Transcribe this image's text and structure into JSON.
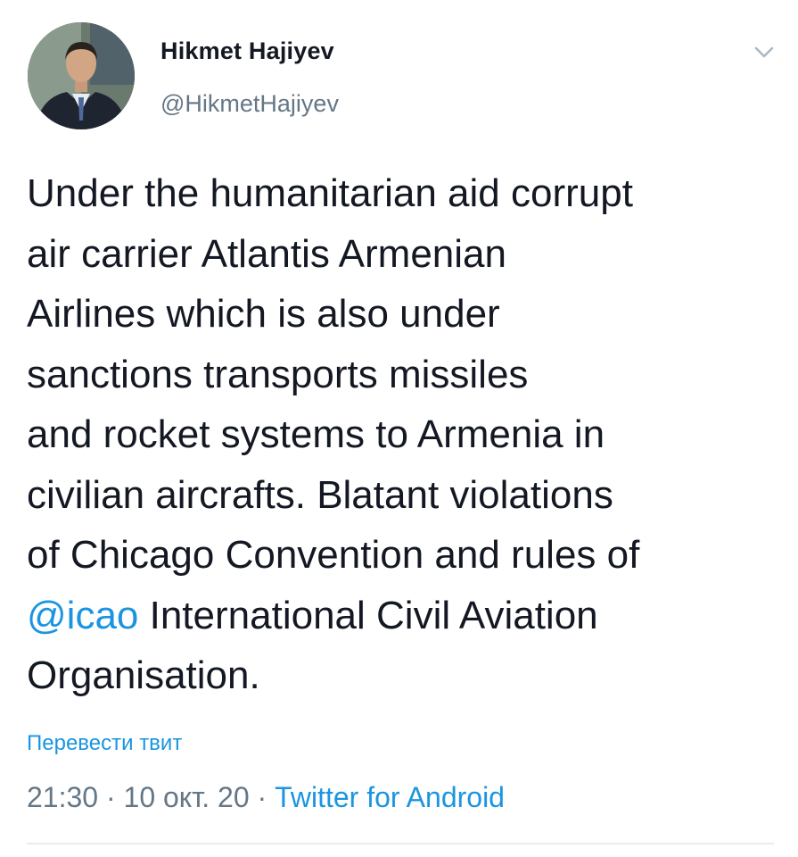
{
  "user": {
    "display_name": "Hikmet Hajiyev",
    "handle": "@HikmetHajiyev",
    "avatar_icon": "user-avatar-photo",
    "menu_icon": "chevron-down-icon"
  },
  "tweet": {
    "lines": [
      "Under the humanitarian aid corrupt",
      "air carrier Atlantis Armenian",
      "Airlines which is also under",
      "sanctions transports missiles",
      "and rocket systems to Armenia in",
      "civilian aircrafts. Blatant violations",
      "of Chicago Convention and rules of"
    ],
    "mention": "@icao",
    "line_after_mention": " International Civil Aviation",
    "last_line": "Organisation."
  },
  "translate_label": "Перевести твит",
  "meta": {
    "time": "21:30",
    "separator": " · ",
    "date": "10 окт. 20",
    "source": "Twitter for Android"
  },
  "colors": {
    "link": "#1b95e0",
    "secondary_text": "#657786",
    "primary_text": "#141823",
    "divider": "#e6ecf0"
  }
}
